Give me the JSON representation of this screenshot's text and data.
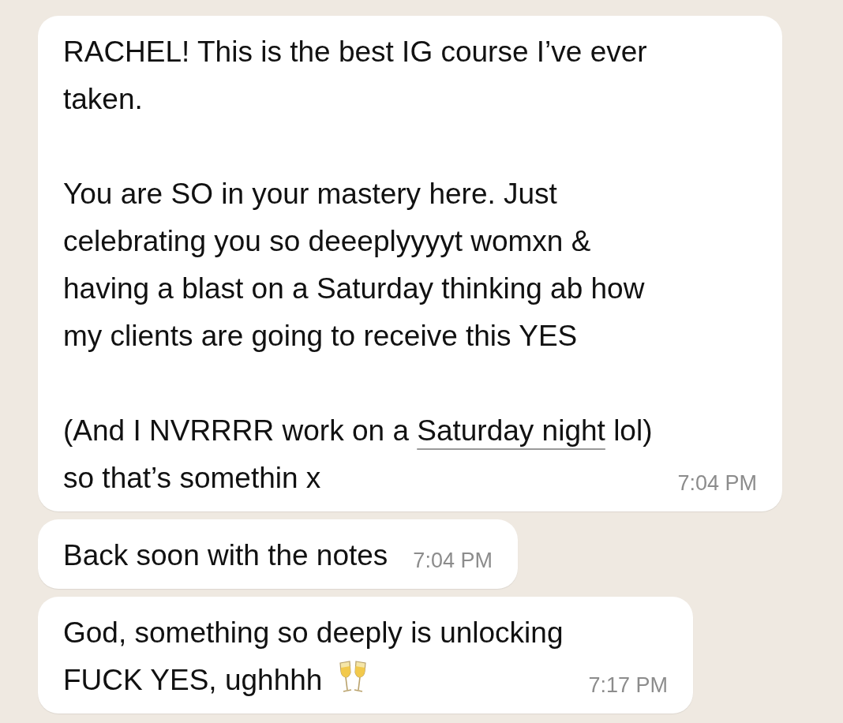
{
  "messages": [
    {
      "paragraphs": [
        {
          "lines": [
            [
              {
                "kind": "text",
                "text": "RACHEL! This is the best IG course I’ve ever"
              }
            ],
            [
              {
                "kind": "text",
                "text": "taken."
              }
            ]
          ]
        },
        {
          "lines": [
            [
              {
                "kind": "text",
                "text": "You are SO in your mastery here. Just"
              }
            ],
            [
              {
                "kind": "text",
                "text": "celebrating you so deeeplyyyyt womxn &"
              }
            ],
            [
              {
                "kind": "text",
                "text": "having a blast on a Saturday thinking ab how"
              }
            ],
            [
              {
                "kind": "text",
                "text": "my clients are going to receive this YES"
              }
            ]
          ]
        },
        {
          "lines": [
            [
              {
                "kind": "text",
                "text": "(And I NVRRRR work on a "
              },
              {
                "kind": "link",
                "text": "Saturday night"
              },
              {
                "kind": "text",
                "text": " lol)"
              }
            ],
            [
              {
                "kind": "text",
                "text": "so that’s somethin x"
              }
            ]
          ]
        }
      ],
      "time": "7:04 PM"
    },
    {
      "paragraphs": [
        {
          "lines": [
            [
              {
                "kind": "text",
                "text": "Back soon with the notes"
              }
            ]
          ]
        }
      ],
      "time": "7:04 PM"
    },
    {
      "paragraphs": [
        {
          "lines": [
            [
              {
                "kind": "text",
                "text": "God, something so deeply is unlocking"
              }
            ],
            [
              {
                "kind": "text",
                "text": "FUCK YES, ughhhh "
              },
              {
                "kind": "icon"
              }
            ]
          ]
        }
      ],
      "time": "7:17 PM"
    }
  ]
}
